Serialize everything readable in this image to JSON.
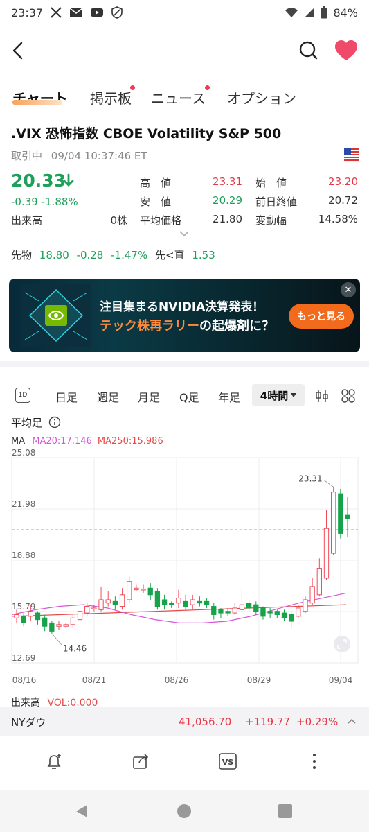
{
  "status_bar": {
    "time": "23:37",
    "battery": "84%",
    "icons": [
      "x-icon",
      "mail-icon",
      "youtube-icon",
      "shield-icon",
      "wifi-icon",
      "signal-icon",
      "battery-icon"
    ]
  },
  "header": {
    "back_icon": "back-arrow-icon",
    "search_icon": "search-icon",
    "favorite_icon": "heart-icon"
  },
  "tabs": [
    {
      "label": "チャート",
      "active": true,
      "dot": false
    },
    {
      "label": "掲示板",
      "active": false,
      "dot": true
    },
    {
      "label": "ニュース",
      "active": false,
      "dot": true
    },
    {
      "label": "オプション",
      "active": false,
      "dot": false
    }
  ],
  "quote": {
    "title": ".VIX  恐怖指数 CBOE Volatility S&P 500",
    "status": "取引中",
    "timestamp": "09/04 10:37:46 ET",
    "price": "20.33",
    "change": "-0.39",
    "change_pct": "-1.88%",
    "volume_label": "出来高",
    "volume_value": "0株",
    "high_label": "高　値",
    "high_value": "23.31",
    "low_label": "安　値",
    "low_value": "20.29",
    "avg_label": "平均価格",
    "avg_value": "21.80",
    "open_label": "始　値",
    "open_value": "23.20",
    "prev_label": "前日終値",
    "prev_value": "20.72",
    "range_label": "変動幅",
    "range_value": "14.58%",
    "colors": {
      "up": "#e63946",
      "down": "#1ea05a"
    }
  },
  "futures": {
    "label": "先物",
    "price": "18.80",
    "change": "-0.28",
    "change_pct": "-1.47%",
    "spread_label": "先<直",
    "spread_value": "1.53"
  },
  "banner": {
    "line1": "注目集まるNVIDIA決算発表！",
    "line2_highlight": "テック株再ラリー",
    "line2_rest": "の起爆剤に？",
    "button": "もっと見る",
    "close": "✕"
  },
  "periods": {
    "day_icon": "1D",
    "items": [
      "日足",
      "週足",
      "月足",
      "Q足",
      "年足"
    ],
    "active": "4時間",
    "tool_icons": [
      "candle-settings-icon",
      "grid-icon"
    ]
  },
  "chart_header": {
    "type_label": "平均足",
    "ma_label": "MA",
    "ma20": "MA20:17.146",
    "ma250": "MA250:15.986"
  },
  "chart_data": {
    "type": "candlestick",
    "style": "heikin-ashi",
    "y_ticks": [
      "25.08",
      "21.98",
      "18.88",
      "15.79",
      "12.69"
    ],
    "ylim": [
      12.69,
      25.08
    ],
    "x_ticks": [
      "08/16",
      "08/21",
      "08/26",
      "08/29",
      "09/04"
    ],
    "reference_line": 20.72,
    "annotations": [
      {
        "text": "23.31",
        "value": 23.31
      },
      {
        "text": "14.46",
        "value": 14.46
      }
    ],
    "candles": [
      {
        "o": 15.4,
        "c": 15.6,
        "h": 15.9,
        "l": 15.1
      },
      {
        "o": 15.5,
        "c": 15.1,
        "h": 15.7,
        "l": 14.9
      },
      {
        "o": 15.5,
        "c": 15.8,
        "h": 16.2,
        "l": 15.2
      },
      {
        "o": 15.7,
        "c": 15.3,
        "h": 15.8,
        "l": 15.0
      },
      {
        "o": 15.4,
        "c": 14.9,
        "h": 15.6,
        "l": 14.6
      },
      {
        "o": 15.1,
        "c": 14.6,
        "h": 15.2,
        "l": 14.46
      },
      {
        "o": 14.9,
        "c": 15.0,
        "h": 15.2,
        "l": 14.7
      },
      {
        "o": 14.9,
        "c": 15.0,
        "h": 15.1,
        "l": 14.8
      },
      {
        "o": 15.0,
        "c": 15.4,
        "h": 15.6,
        "l": 14.8
      },
      {
        "o": 15.3,
        "c": 15.8,
        "h": 16.0,
        "l": 15.0
      },
      {
        "o": 15.7,
        "c": 16.1,
        "h": 16.3,
        "l": 15.5
      },
      {
        "o": 16.0,
        "c": 16.0,
        "h": 16.2,
        "l": 15.8
      },
      {
        "o": 15.9,
        "c": 16.5,
        "h": 17.3,
        "l": 15.8
      },
      {
        "o": 16.3,
        "c": 16.5,
        "h": 17.0,
        "l": 16.1
      },
      {
        "o": 16.4,
        "c": 16.2,
        "h": 16.7,
        "l": 15.9
      },
      {
        "o": 16.1,
        "c": 16.8,
        "h": 17.2,
        "l": 15.9
      },
      {
        "o": 16.5,
        "c": 17.6,
        "h": 17.9,
        "l": 16.3
      },
      {
        "o": 17.1,
        "c": 17.2,
        "h": 17.4,
        "l": 17.0
      },
      {
        "o": 17.1,
        "c": 17.15,
        "h": 17.4,
        "l": 16.9
      },
      {
        "o": 17.2,
        "c": 16.8,
        "h": 17.5,
        "l": 16.5
      },
      {
        "o": 17.0,
        "c": 16.1,
        "h": 17.2,
        "l": 15.9
      },
      {
        "o": 16.5,
        "c": 16.2,
        "h": 16.8,
        "l": 15.9
      },
      {
        "o": 16.3,
        "c": 16.2,
        "h": 16.4,
        "l": 16.0
      },
      {
        "o": 16.3,
        "c": 16.6,
        "h": 17.1,
        "l": 16.0
      },
      {
        "o": 16.4,
        "c": 16.1,
        "h": 16.8,
        "l": 15.9
      },
      {
        "o": 16.2,
        "c": 16.5,
        "h": 16.8,
        "l": 15.9
      },
      {
        "o": 16.4,
        "c": 16.3,
        "h": 16.7,
        "l": 16.1
      },
      {
        "o": 16.4,
        "c": 16.2,
        "h": 16.6,
        "l": 16.0
      },
      {
        "o": 16.1,
        "c": 15.6,
        "h": 16.3,
        "l": 15.3
      },
      {
        "o": 15.9,
        "c": 15.7,
        "h": 16.0,
        "l": 15.4
      },
      {
        "o": 15.8,
        "c": 15.7,
        "h": 16.0,
        "l": 15.5
      },
      {
        "o": 15.7,
        "c": 16.0,
        "h": 16.3,
        "l": 15.6
      },
      {
        "o": 15.9,
        "c": 16.2,
        "h": 17.3,
        "l": 15.8
      },
      {
        "o": 16.3,
        "c": 16.0,
        "h": 16.5,
        "l": 15.8
      },
      {
        "o": 16.2,
        "c": 15.8,
        "h": 16.4,
        "l": 15.6
      },
      {
        "o": 16.0,
        "c": 15.5,
        "h": 16.1,
        "l": 15.3
      },
      {
        "o": 15.8,
        "c": 15.7,
        "h": 16.0,
        "l": 15.4
      },
      {
        "o": 15.8,
        "c": 15.6,
        "h": 15.9,
        "l": 15.4
      },
      {
        "o": 15.7,
        "c": 15.4,
        "h": 15.9,
        "l": 15.2
      },
      {
        "o": 15.6,
        "c": 15.2,
        "h": 15.8,
        "l": 14.8
      },
      {
        "o": 15.5,
        "c": 16.0,
        "h": 16.2,
        "l": 15.4
      },
      {
        "o": 15.8,
        "c": 16.5,
        "h": 16.7,
        "l": 15.7
      },
      {
        "o": 16.3,
        "c": 17.3,
        "h": 17.8,
        "l": 16.2
      },
      {
        "o": 16.8,
        "c": 18.4,
        "h": 19.0,
        "l": 16.7
      },
      {
        "o": 17.8,
        "c": 20.8,
        "h": 21.9,
        "l": 17.7
      },
      {
        "o": 19.3,
        "c": 23.0,
        "h": 23.31,
        "l": 19.2
      },
      {
        "o": 22.9,
        "c": 20.5,
        "h": 23.2,
        "l": 20.2
      },
      {
        "o": 21.6,
        "c": 21.4,
        "h": 22.7,
        "l": 20.3
      }
    ],
    "ma20": [
      15.6,
      15.9,
      16.1,
      16.2,
      16.0,
      15.6,
      15.3,
      15.1,
      15.1,
      15.2,
      15.5,
      15.9,
      16.3,
      16.6,
      16.9
    ],
    "ma250": [
      15.5,
      15.55,
      15.6,
      15.65,
      15.7,
      15.75,
      15.8,
      15.85,
      15.9,
      15.95,
      16.0,
      16.05,
      16.1,
      16.15,
      16.2
    ],
    "colors": {
      "up": "#ef4a5a",
      "down": "#16a34a",
      "ma20": "#d855d8",
      "ma250": "#e24a4a",
      "ref": "#f28c38"
    }
  },
  "volume_row": {
    "label": "出来高",
    "value": "VOL:0.000"
  },
  "dow": {
    "name": "NYダウ",
    "value": "41,056.70",
    "change": "+119.77",
    "pct": "+0.29%"
  },
  "actions": [
    "alert-add-icon",
    "share-icon",
    "compare-vs-icon",
    "more-vertical-icon"
  ],
  "nav": [
    "nav-back-icon",
    "nav-home-icon",
    "nav-recents-icon"
  ]
}
